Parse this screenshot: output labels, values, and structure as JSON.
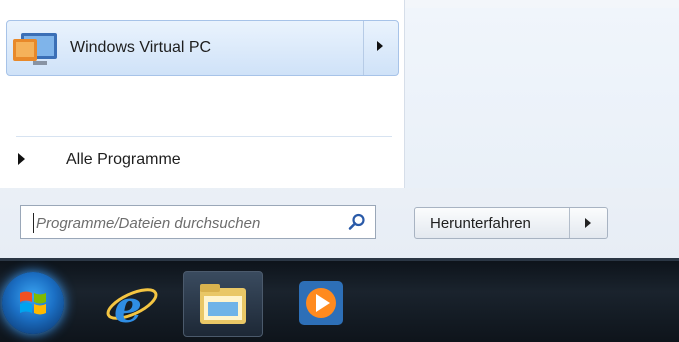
{
  "start_menu": {
    "pinned_programs": [
      {
        "label": "Windows Virtual PC",
        "icon": "virtual-pc-icon",
        "has_submenu": true
      }
    ],
    "all_programs_label": "Alle Programme",
    "search": {
      "placeholder": "Programme/Dateien durchsuchen",
      "value": ""
    },
    "shutdown_label": "Herunterfahren"
  },
  "taskbar": {
    "items": [
      {
        "icon": "start-orb-icon"
      },
      {
        "icon": "internet-explorer-icon"
      },
      {
        "icon": "windows-explorer-icon",
        "active": true
      },
      {
        "icon": "media-player-icon"
      }
    ]
  },
  "colors": {
    "accent": "#cfe2f8",
    "taskbar": "#111922"
  }
}
